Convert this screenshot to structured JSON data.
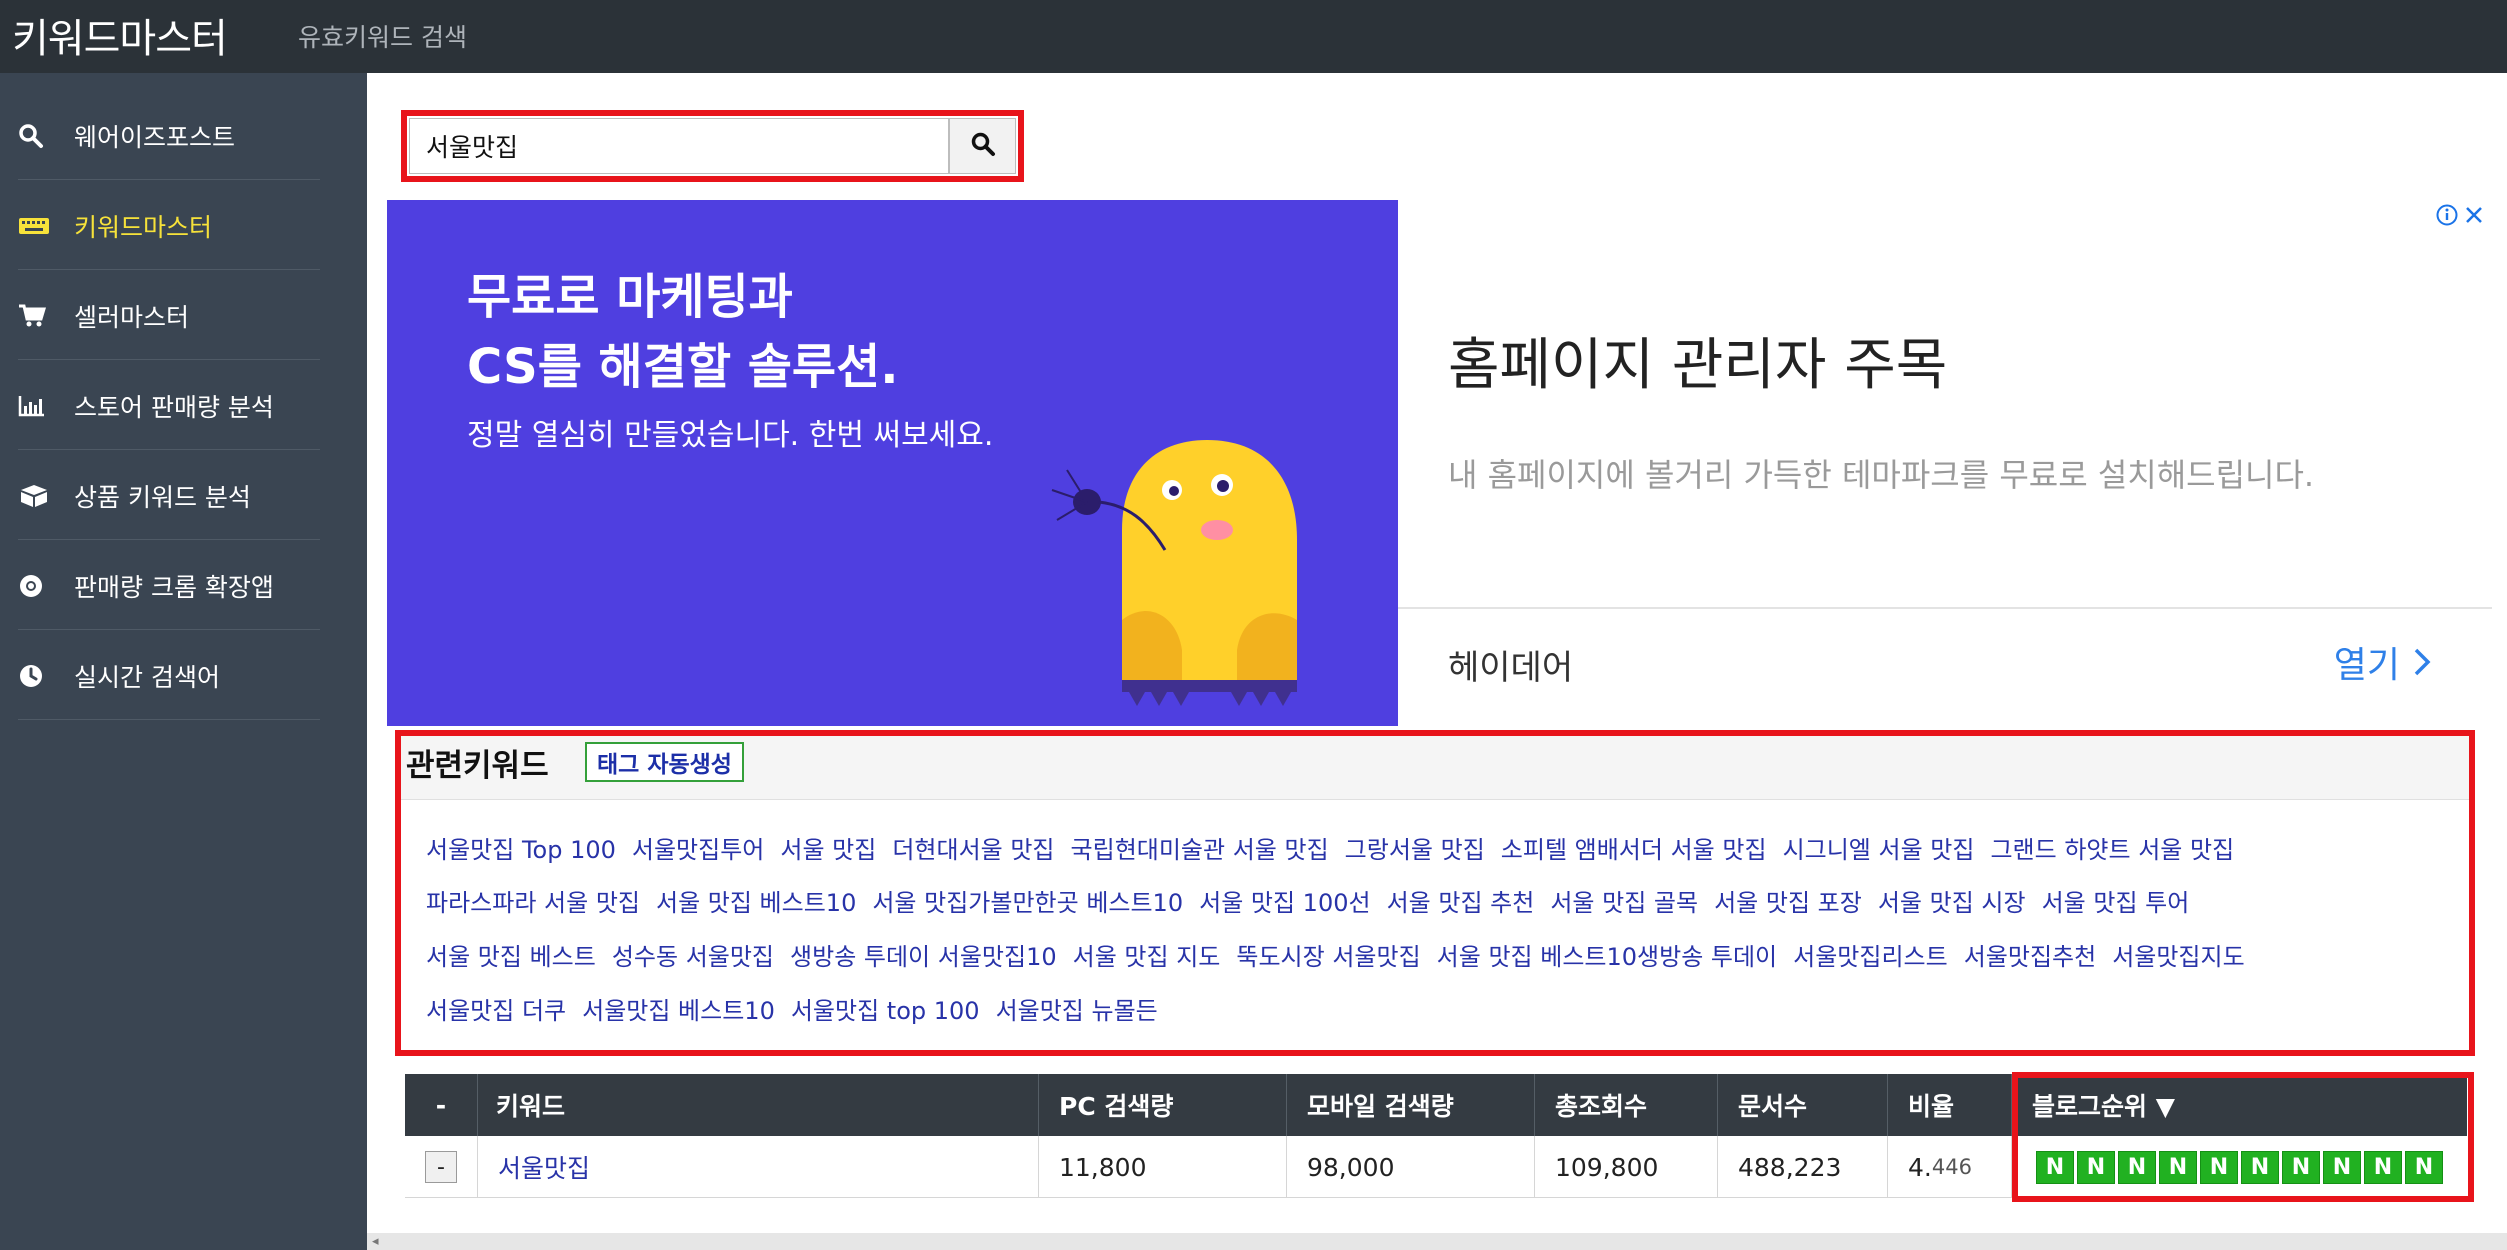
{
  "header": {
    "brand": "키워드마스터",
    "subtitle": "유효키워드 검색"
  },
  "sidebar": {
    "items": [
      {
        "label": "웨어이즈포스트",
        "icon": "search-icon",
        "active": false
      },
      {
        "label": "키워드마스터",
        "icon": "keyboard-icon",
        "active": true
      },
      {
        "label": "셀러마스터",
        "icon": "cart-icon",
        "active": false
      },
      {
        "label": "스토어 판매량 분석",
        "icon": "bar-chart-icon",
        "active": false
      },
      {
        "label": "상품 키워드 분석",
        "icon": "box-icon",
        "active": false
      },
      {
        "label": "판매량 크롬 확장앱",
        "icon": "chrome-icon",
        "active": false
      },
      {
        "label": "실시간 검색어",
        "icon": "clock-icon",
        "active": false
      }
    ]
  },
  "search": {
    "value": "서울맛집",
    "button_icon": "search-icon"
  },
  "ad": {
    "headline_1": "무료로 마케팅과",
    "headline_2": "CS를 해결할 솔루션.",
    "sub": "정말 열심히 만들었습니다. 한번 써보세요.",
    "title": "홈페이지 관리자 주목",
    "description": "내 홈페이지에 볼거리 가득한 테마파크를 무료로 설치해드립니다.",
    "advertiser": "헤이데어",
    "open_label": "열기",
    "bg_color": "#4f3fe0",
    "accent_color": "#2f80e8"
  },
  "related": {
    "title": "관련키워드",
    "tag_button": "태그 자동생성",
    "lines": [
      [
        "서울맛집 Top 100",
        "서울맛집투어",
        "서울 맛집",
        "더현대서울 맛집",
        "국립현대미술관 서울 맛집",
        "그랑서울 맛집",
        "소피텔 앰배서더 서울 맛집",
        "시그니엘 서울 맛집",
        "그랜드 하얏트 서울 맛집"
      ],
      [
        "파라스파라 서울 맛집",
        "서울 맛집 베스트10",
        "서울 맛집가볼만한곳 베스트10",
        "서울 맛집 100선",
        "서울 맛집 추천",
        "서울 맛집 골목",
        "서울 맛집 포장",
        "서울 맛집 시장",
        "서울 맛집 투어"
      ],
      [
        "서울 맛집 베스트",
        "성수동 서울맛집",
        "생방송 투데이 서울맛집10",
        "서울 맛집 지도",
        "뚝도시장 서울맛집",
        "서울 맛집 베스트10생방송 투데이",
        "서울맛집리스트",
        "서울맛집추천",
        "서울맛집지도"
      ],
      [
        "서울맛집 더쿠",
        "서울맛집 베스트10",
        "서울맛집 top 100",
        "서울맛집 뉴몰든"
      ]
    ]
  },
  "table": {
    "headers": {
      "dash": "-",
      "keyword": "키워드",
      "pc": "PC 검색량",
      "mobile": "모바일 검색량",
      "total": "총조회수",
      "docs": "문서수",
      "ratio": "비율",
      "blog_rank": "블로그순위 ▼"
    },
    "row": {
      "minus": "-",
      "keyword": "서울맛집",
      "pc": "11,800",
      "mobile": "98,000",
      "total": "109,800",
      "docs": "488,223",
      "ratio_int": "4.",
      "ratio_dec": "446",
      "ranks": [
        "N",
        "N",
        "N",
        "N",
        "N",
        "N",
        "N",
        "N",
        "N",
        "N"
      ]
    }
  }
}
